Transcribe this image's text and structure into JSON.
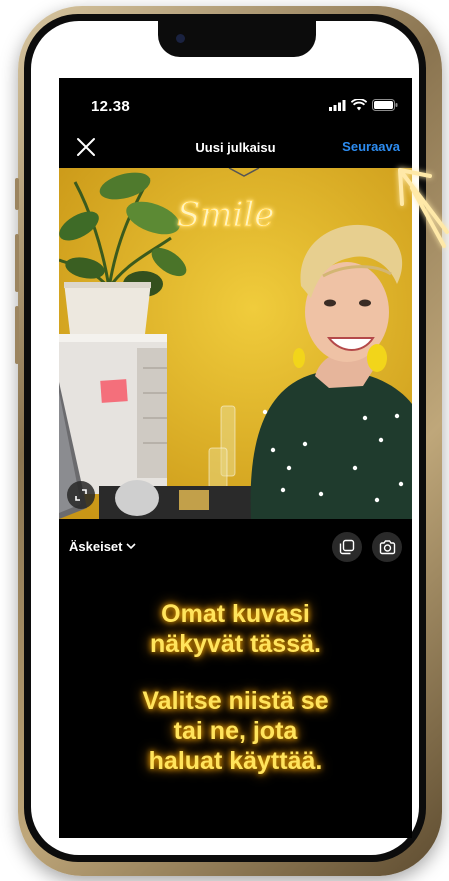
{
  "status_bar": {
    "time": "12.38"
  },
  "nav": {
    "title": "Uusi julkaisu",
    "next_label": "Seuraava"
  },
  "photo": {
    "neon_sign": "Smile"
  },
  "toolbar": {
    "album_label": "Äskeiset"
  },
  "overlay": {
    "line1": "Omat kuvasi",
    "line2": "näkyvät tässä.",
    "line3": "Valitse niistä se",
    "line4": "tai ne, jota",
    "line5": "haluat käyttää."
  },
  "colors": {
    "accent_blue": "#2d8cf0",
    "neon_yellow": "#ffe45c",
    "wall_yellow": "#e0b523"
  }
}
